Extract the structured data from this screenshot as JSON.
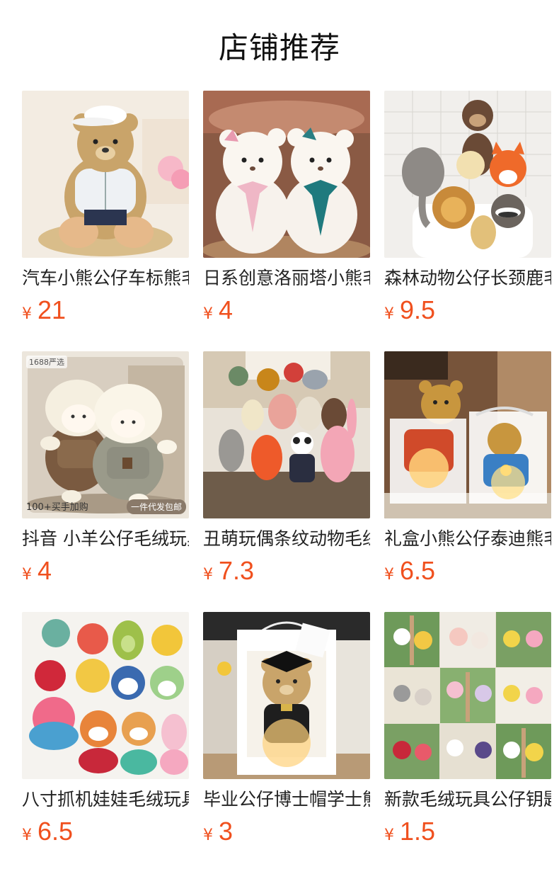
{
  "header": {
    "title": "店铺推荐"
  },
  "products": [
    {
      "name": "汽车小熊公仔车标熊毛绒玩具",
      "currency": "¥",
      "price": "21",
      "image": "teddy-bear-with-white-cap"
    },
    {
      "name": "日系创意洛丽塔小熊毛绒玩具",
      "currency": "¥",
      "price": "4",
      "image": "two-white-lolita-bears"
    },
    {
      "name": "森林动物公仔长颈鹿毛绒玩具",
      "currency": "¥",
      "price": "9.5",
      "image": "forest-animal-plushies"
    },
    {
      "name": "抖音 小羊公仔毛绒玩具",
      "currency": "¥",
      "price": "4",
      "image": "two-sheep-plushies",
      "badges": {
        "top_left": "1688严选",
        "bottom_left": "100+买手加购",
        "bottom_right": "一件代发包邮"
      }
    },
    {
      "name": "丑萌玩偶条纹动物毛绒玩具",
      "currency": "¥",
      "price": "7.3",
      "image": "striped-animal-plushies"
    },
    {
      "name": "礼盒小熊公仔泰迪熊毛绒玩具",
      "currency": "¥",
      "price": "6.5",
      "image": "gift-box-teddy-bears"
    },
    {
      "name": "八寸抓机娃娃毛绒玩具",
      "currency": "¥",
      "price": "6.5",
      "image": "claw-machine-plushies"
    },
    {
      "name": "毕业公仔博士帽学士熊毛绒玩具",
      "currency": "¥",
      "price": "3",
      "image": "graduation-bear-gift-bag"
    },
    {
      "name": "新款毛绒玩具公仔钥匙扣",
      "currency": "¥",
      "price": "1.5",
      "image": "keychain-plush-collage"
    }
  ]
}
